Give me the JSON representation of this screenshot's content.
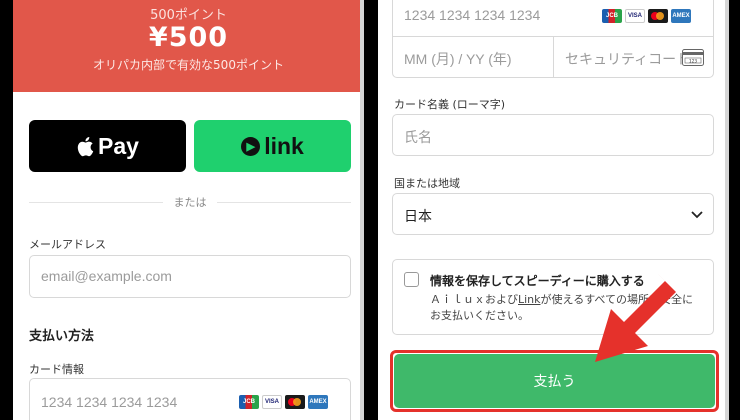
{
  "left": {
    "hero": {
      "points_label": "500ポイント",
      "amount": "¥500",
      "note": "オリパカ内部で有効な500ポイント"
    },
    "apple_pay": {
      "icon": "apple-icon",
      "label": "Pay"
    },
    "link": {
      "icon": "arrow-right-icon",
      "label": "link"
    },
    "divider_text": "または",
    "email": {
      "label": "メールアドレス",
      "placeholder": "email@example.com"
    },
    "payment_method_title": "支払い方法",
    "card_info_label": "カード情報",
    "card_number_placeholder": "1234 1234 1234 1234",
    "card_brands": [
      "JCB",
      "VISA",
      "MC",
      "AMEX"
    ]
  },
  "right": {
    "card_number_placeholder": "1234 1234 1234 1234",
    "card_brands": [
      "JCB",
      "VISA",
      "MC",
      "AMEX"
    ],
    "expiry_placeholder": "MM (月) / YY (年)",
    "cvc_placeholder": "セキュリティコード",
    "cvc_icon": "card-back-icon",
    "name": {
      "label": "カード名義 (ローマ字)",
      "placeholder": "氏名"
    },
    "country": {
      "label": "国または地域",
      "value": "日本"
    },
    "save_info": {
      "title": "情報を保存してスピーディーに購入する",
      "desc_prefix": "Ａｉｌｕｘおよび",
      "desc_link": "Link",
      "desc_suffix": "が使えるすべての場所で安全にお支払いください。"
    },
    "pay_button": "支払う"
  },
  "colors": {
    "hero": "#e1574a",
    "link_green": "#1fd06e",
    "pay_green": "#3fb96a",
    "annotation_red": "#e5312b"
  }
}
